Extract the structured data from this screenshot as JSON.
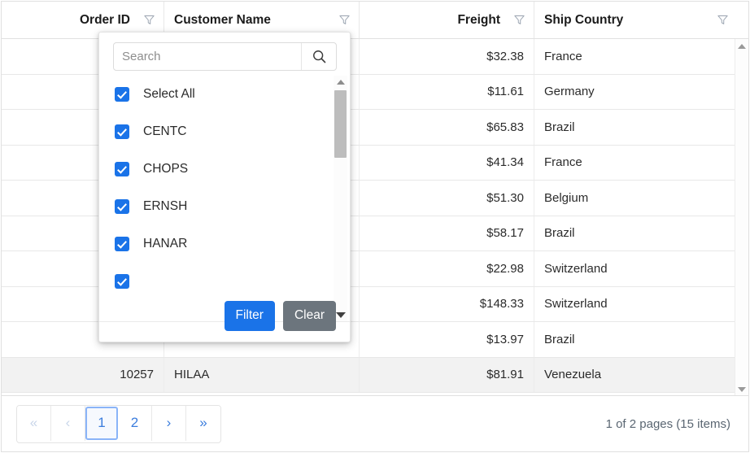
{
  "grid": {
    "columns": [
      {
        "key": "order_id",
        "label": "Order ID",
        "filter_icon": "filter-funnel-icon"
      },
      {
        "key": "customer_name",
        "label": "Customer Name",
        "filter_icon": "filter-funnel-icon"
      },
      {
        "key": "freight",
        "label": "Freight",
        "filter_icon": "filter-funnel-icon"
      },
      {
        "key": "ship_country",
        "label": "Ship Country",
        "filter_icon": "filter-funnel-icon"
      }
    ],
    "rows": [
      {
        "order_id": "",
        "customer_name": "",
        "freight": "$32.38",
        "ship_country": "France"
      },
      {
        "order_id": "",
        "customer_name": "",
        "freight": "$11.61",
        "ship_country": "Germany"
      },
      {
        "order_id": "",
        "customer_name": "",
        "freight": "$65.83",
        "ship_country": "Brazil"
      },
      {
        "order_id": "",
        "customer_name": "",
        "freight": "$41.34",
        "ship_country": "France"
      },
      {
        "order_id": "",
        "customer_name": "",
        "freight": "$51.30",
        "ship_country": "Belgium"
      },
      {
        "order_id": "",
        "customer_name": "",
        "freight": "$58.17",
        "ship_country": "Brazil"
      },
      {
        "order_id": "",
        "customer_name": "",
        "freight": "$22.98",
        "ship_country": "Switzerland"
      },
      {
        "order_id": "",
        "customer_name": "",
        "freight": "$148.33",
        "ship_country": "Switzerland"
      },
      {
        "order_id": "",
        "customer_name": "",
        "freight": "$13.97",
        "ship_country": "Brazil"
      },
      {
        "order_id": "10257",
        "customer_name": "HILAA",
        "freight": "$81.91",
        "ship_country": "Venezuela"
      }
    ]
  },
  "filter_popup": {
    "search": {
      "value": "",
      "placeholder": "Search",
      "icon": "search-icon"
    },
    "items": [
      {
        "label": "Select All",
        "checked": true
      },
      {
        "label": "CENTC",
        "checked": true
      },
      {
        "label": "CHOPS",
        "checked": true
      },
      {
        "label": "ERNSH",
        "checked": true
      },
      {
        "label": "HANAR",
        "checked": true
      }
    ],
    "buttons": {
      "filter": "Filter",
      "clear": "Clear"
    }
  },
  "pager": {
    "first_label": "«",
    "prev_label": "‹",
    "pages": [
      "1",
      "2"
    ],
    "active_page": "1",
    "next_label": "›",
    "last_label": "»",
    "info": "1 of 2 pages (15 items)"
  },
  "colors": {
    "accent": "#1a73e8",
    "secondary": "#6c757d",
    "pager_link": "#3b7ddd",
    "border": "#e0e0e0"
  }
}
